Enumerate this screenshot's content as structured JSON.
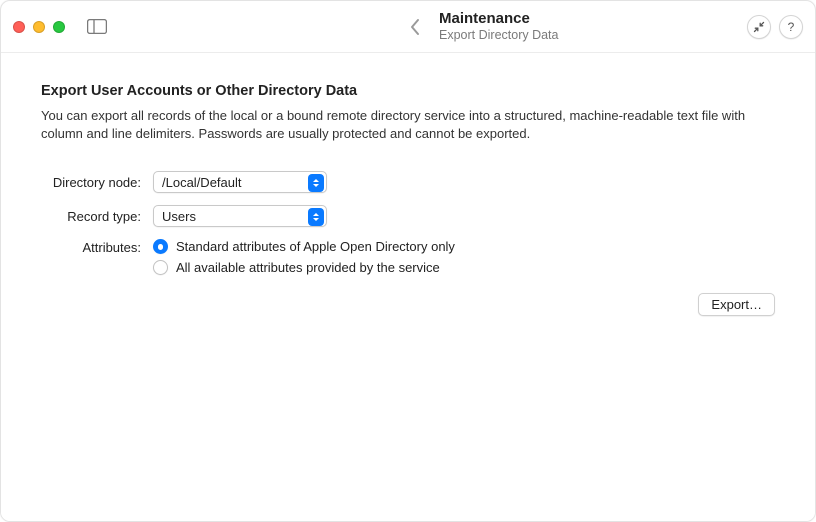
{
  "titlebar": {
    "title": "Maintenance",
    "subtitle": "Export Directory Data"
  },
  "content": {
    "heading": "Export User Accounts or Other Directory Data",
    "description": "You can export all records of the local or a bound remote directory service into a structured, machine-readable text file with column and line delimiters. Passwords are usually protected and cannot be exported."
  },
  "form": {
    "directory_node": {
      "label": "Directory node:",
      "value": "/Local/Default"
    },
    "record_type": {
      "label": "Record type:",
      "value": "Users"
    },
    "attributes": {
      "label": "Attributes:",
      "options": [
        "Standard attributes of Apple Open Directory only",
        "All available attributes provided by the service"
      ],
      "selected_index": 0
    }
  },
  "actions": {
    "export_label": "Export…"
  },
  "help_glyph": "?"
}
